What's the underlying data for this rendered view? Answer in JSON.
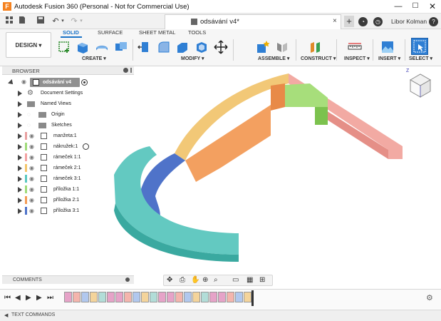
{
  "window": {
    "title": "Autodesk Fusion 360 (Personal - Not for Commercial Use)",
    "app_icon": "F",
    "minimize": "—",
    "maximize": "☐",
    "close": "✕"
  },
  "document_tab": {
    "label": "odsávání v4*",
    "close": "×",
    "new_tab": "+"
  },
  "user": {
    "name": "Libor Kolman",
    "help": "?"
  },
  "toolbar": {
    "workspace": "DESIGN ▾",
    "tabs": [
      "SOLID",
      "SURFACE",
      "SHEET METAL",
      "TOOLS"
    ],
    "active_tab": "SOLID",
    "groups": [
      "CREATE ▾",
      "MODIFY ▾",
      "ASSEMBLE ▾",
      "CONSTRUCT ▾",
      "INSPECT ▾",
      "INSERT ▾",
      "SELECT ▾"
    ]
  },
  "browser": {
    "title": "BROWSER",
    "root": "odsávání v4",
    "items": [
      {
        "label": "Document Settings"
      },
      {
        "label": "Named Views"
      },
      {
        "label": "Origin"
      },
      {
        "label": "Sketches"
      },
      {
        "label": "manžeta:1",
        "color": "#e9a0a0"
      },
      {
        "label": "nákružek:1",
        "color": "#9fdb7a"
      },
      {
        "label": "rámeček 1:1",
        "color": "#f3a2a2"
      },
      {
        "label": "rámeček 2:1",
        "color": "#f4c56a"
      },
      {
        "label": "rámeček 3:1",
        "color": "#59c8c0"
      },
      {
        "label": "příložka 1:1",
        "color": "#9fdb7a"
      },
      {
        "label": "příložka 2:1",
        "color": "#f39b55"
      },
      {
        "label": "příložka 3:1",
        "color": "#4f73c9"
      }
    ]
  },
  "comments": {
    "title": "COMMENTS"
  },
  "text_commands": {
    "title": "TEXT COMMANDS"
  },
  "viewcube": {
    "face_labels": [
      "Z"
    ],
    "colors": {
      "front": "#ffffff",
      "edge": "#6b6bb5"
    }
  },
  "model_colors": {
    "pink": "#efa19a",
    "green": "#97d460",
    "orange": "#f39a5c",
    "yellow": "#f0c070",
    "teal": "#63c9c1",
    "blue": "#4f73c9"
  },
  "timeline": {
    "colors": [
      "#e6a3c8",
      "#f4b5ad",
      "#b1c8ee",
      "#f4d49b",
      "#b2ddd8",
      "#e6a3c8"
    ]
  }
}
